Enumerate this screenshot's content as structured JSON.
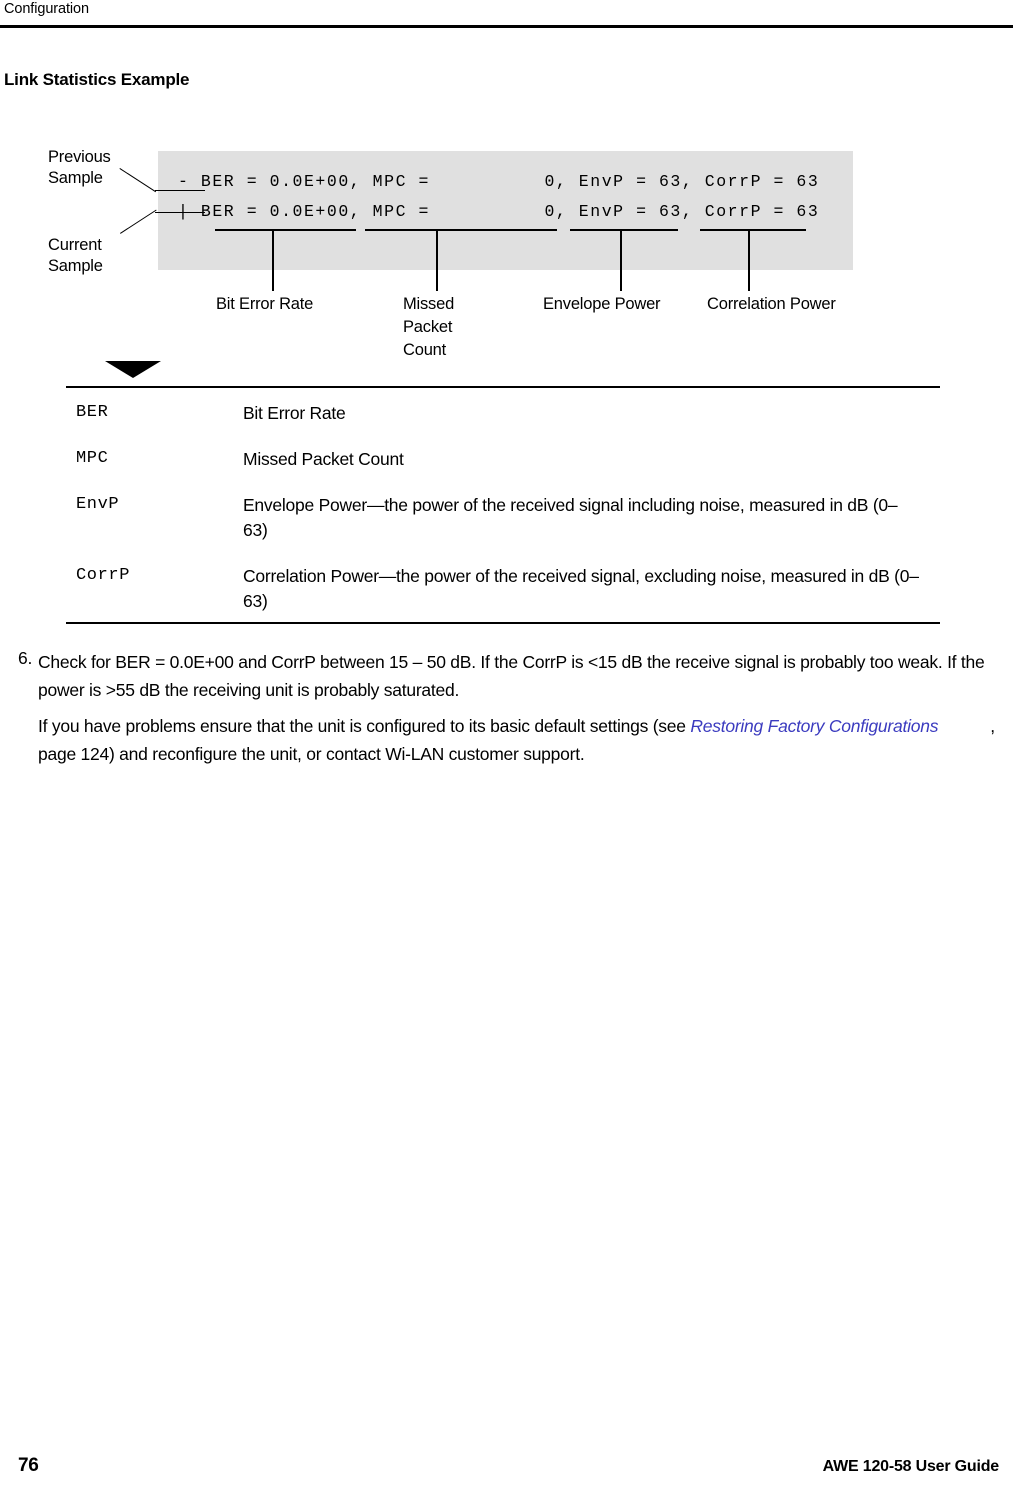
{
  "header": {
    "running_head": "Configuration"
  },
  "section": {
    "title": "Link Statistics Example"
  },
  "figure": {
    "callouts": {
      "previous_sample": "Previous\nSample",
      "current_sample": "Current\nSample"
    },
    "code_lines": [
      "- BER = 0.0E+00, MPC =          0, EnvP = 63, CorrP = 63",
      "| BER = 0.0E+00, MPC =          0, EnvP = 63, CorrP = 63"
    ],
    "annotations": [
      "Bit Error Rate",
      "Missed\nPacket\nCount",
      "Envelope Power",
      "Correlation Power"
    ]
  },
  "definitions": [
    {
      "term": "BER",
      "description": "Bit Error Rate"
    },
    {
      "term": "MPC",
      "description": "Missed Packet Count"
    },
    {
      "term": "EnvP",
      "description": "Envelope Power—the power of the received signal including noise, measured in dB (0–63)"
    },
    {
      "term": "CorrP",
      "description": "Correlation Power—the power of the received signal, excluding noise, measured in dB (0–63)"
    }
  ],
  "step": {
    "number": "6.",
    "text": "Check for BER = 0.0E+00 and CorrP between 15 – 50 dB. If the CorrP is <15 dB the receive signal is probably too weak. If the power is >55 dB the receiving unit is probably saturated."
  },
  "paragraph": {
    "part1": "If you have problems ensure that the unit is configured to its basic default settings (see ",
    "xref1": "Restoring",
    "xref2": "Factory Configurations",
    "part2": ", page 124) and reconfigure the unit, or contact Wi-LAN customer support."
  },
  "footer": {
    "page_number": "76",
    "guide_title": "AWE 120-58 User Guide"
  },
  "colors": {
    "code_background": "#e0e0e0",
    "xref_link": "#3b3bbf",
    "rule": "#000000"
  }
}
